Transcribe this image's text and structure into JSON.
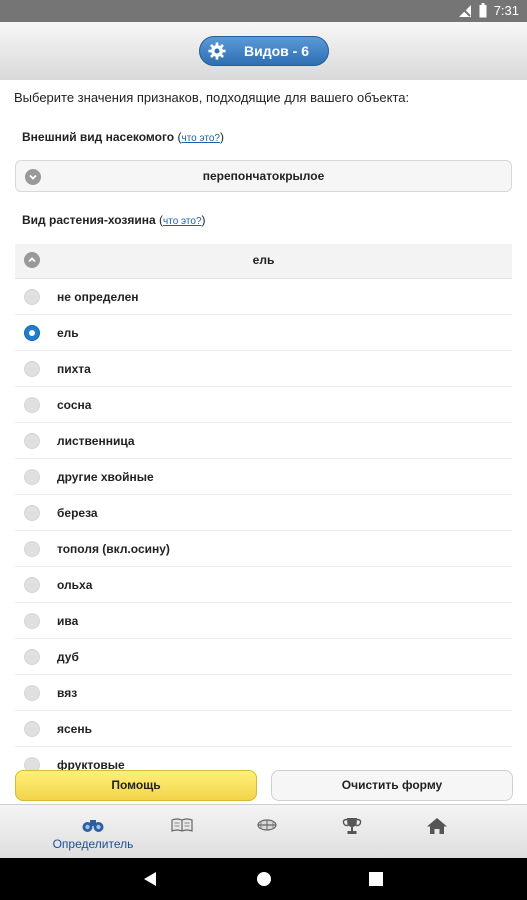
{
  "status_bar": {
    "time": "7:31"
  },
  "header": {
    "species_button_label": "Видов - 6"
  },
  "instruction": "Выберите значения признаков, подходящие для вашего объекта:",
  "attributes": [
    {
      "label": "Внешний вид насекомого",
      "help_link": "что это?",
      "selected": "перепончатокрылое"
    },
    {
      "label": "Вид растения-хозяина",
      "help_link": "что это?",
      "selected": "ель"
    }
  ],
  "host_options": [
    {
      "label": "не определен",
      "checked": false
    },
    {
      "label": "ель",
      "checked": true
    },
    {
      "label": "пихта",
      "checked": false
    },
    {
      "label": "сосна",
      "checked": false
    },
    {
      "label": "лиственница",
      "checked": false
    },
    {
      "label": "другие хвойные",
      "checked": false
    },
    {
      "label": "береза",
      "checked": false
    },
    {
      "label": "тополя (вкл.осину)",
      "checked": false
    },
    {
      "label": "ольха",
      "checked": false
    },
    {
      "label": "ива",
      "checked": false
    },
    {
      "label": "дуб",
      "checked": false
    },
    {
      "label": "вяз",
      "checked": false
    },
    {
      "label": "ясень",
      "checked": false
    },
    {
      "label": "фруктовые",
      "checked": false
    }
  ],
  "buttons": {
    "help": "Помощь",
    "clear": "Очистить форму"
  },
  "tabs": [
    {
      "label": "Определитель",
      "icon": "binoculars-icon",
      "active": true
    },
    {
      "label": "",
      "icon": "book-icon",
      "active": false
    },
    {
      "label": "",
      "icon": "insect-icon",
      "active": false
    },
    {
      "label": "",
      "icon": "trophy-icon",
      "active": false
    },
    {
      "label": "",
      "icon": "home-icon",
      "active": false
    }
  ],
  "colors": {
    "accent": "#2f6fb2",
    "help_button": "#f3d44a",
    "tab_label": "#1c4f94"
  }
}
